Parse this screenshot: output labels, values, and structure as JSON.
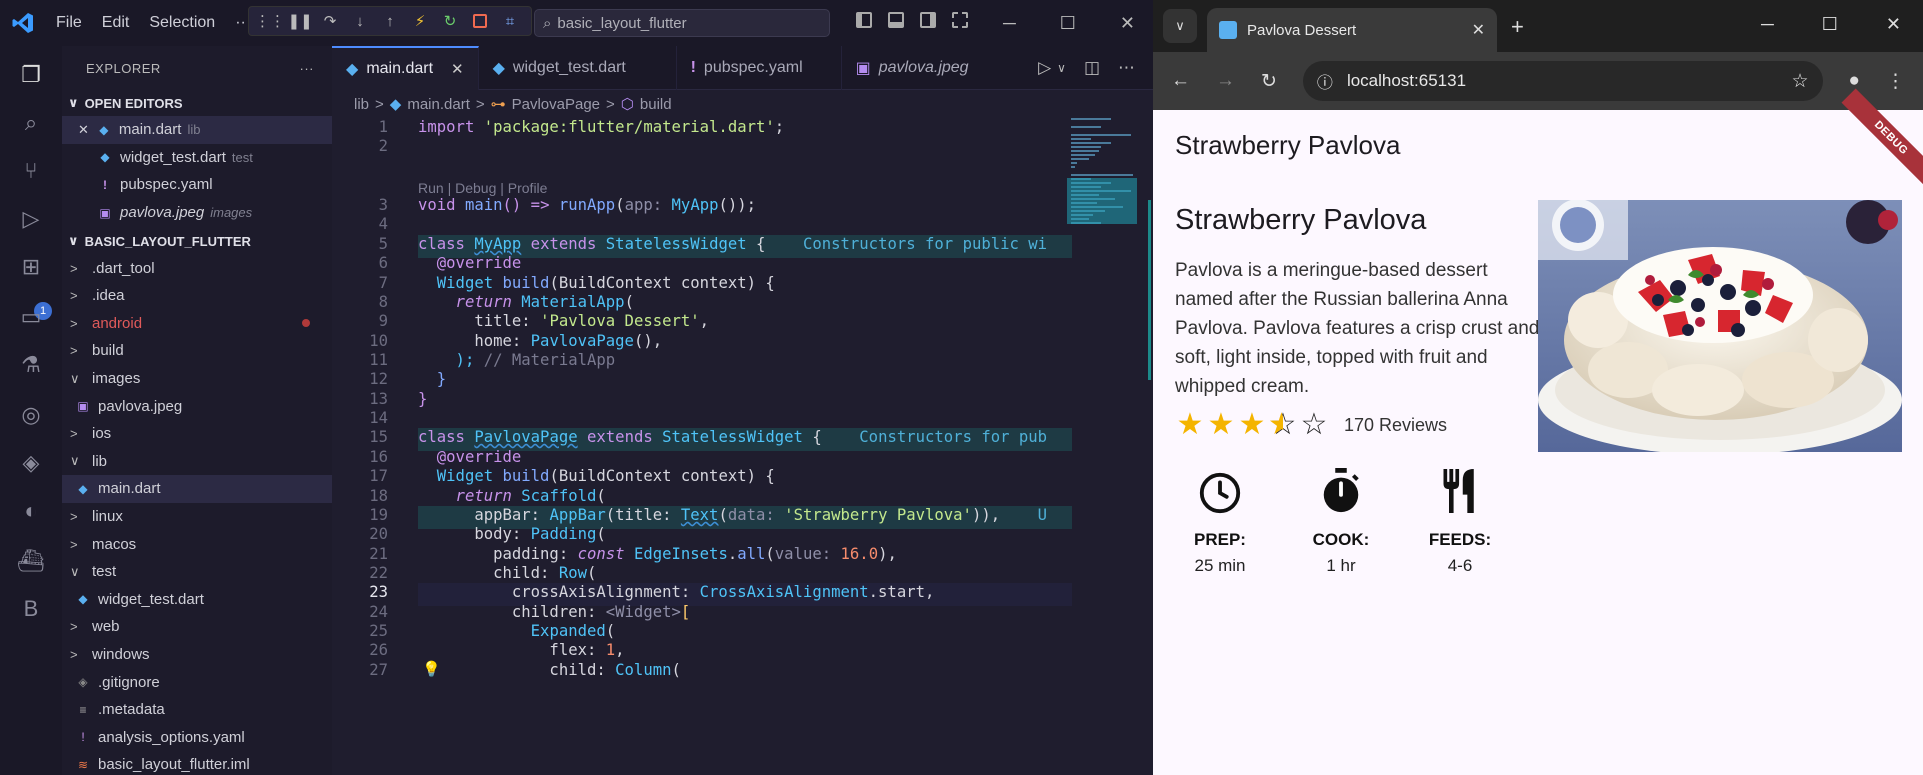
{
  "vscode": {
    "menu": [
      "File",
      "Edit",
      "Selection",
      "··"
    ],
    "search_text": "basic_layout_flutter",
    "activity_badge": "1",
    "explorer_title": "EXPLORER",
    "explorer_more": "···",
    "open_editors_title": "OPEN EDITORS",
    "open_editors": [
      {
        "close": "✕",
        "name": "main.dart",
        "desc": "lib"
      },
      {
        "name": "widget_test.dart",
        "desc": "test"
      },
      {
        "name": "pubspec.yaml",
        "desc": ""
      },
      {
        "name": "pavlova.jpeg",
        "desc": "images"
      }
    ],
    "project_title": "BASIC_LAYOUT_FLUTTER",
    "tree": [
      {
        "name": ".dart_tool",
        "chev": ">"
      },
      {
        "name": ".idea",
        "chev": ">"
      },
      {
        "name": "android",
        "chev": ">"
      },
      {
        "name": "build",
        "chev": ">"
      },
      {
        "name": "images",
        "chev": "∨"
      },
      {
        "name": "pavlova.jpeg",
        "chev": ""
      },
      {
        "name": "ios",
        "chev": ">"
      },
      {
        "name": "lib",
        "chev": "∨"
      },
      {
        "name": "main.dart",
        "chev": ""
      },
      {
        "name": "linux",
        "chev": ">"
      },
      {
        "name": "macos",
        "chev": ">"
      },
      {
        "name": "test",
        "chev": "∨"
      },
      {
        "name": "widget_test.dart",
        "chev": ""
      },
      {
        "name": "web",
        "chev": ">"
      },
      {
        "name": "windows",
        "chev": ">"
      },
      {
        "name": ".gitignore",
        "chev": ""
      },
      {
        "name": ".metadata",
        "chev": ""
      },
      {
        "name": "analysis_options.yaml",
        "chev": ""
      },
      {
        "name": "basic_layout_flutter.iml",
        "chev": ""
      }
    ],
    "tabs": [
      {
        "name": "main.dart",
        "close": "✕"
      },
      {
        "name": "widget_test.dart"
      },
      {
        "name": "pubspec.yaml"
      },
      {
        "name": "pavlova.jpeg"
      }
    ],
    "breadcrumb": [
      "lib",
      ">",
      "main.dart",
      ">",
      "PavlovaPage",
      ">",
      "build"
    ],
    "codelens": "Run | Debug | Profile",
    "line_numbers": [
      "1",
      "2",
      "3",
      "4",
      "5",
      "6",
      "7",
      "8",
      "9",
      "10",
      "11",
      "12",
      "13",
      "14",
      "15",
      "16",
      "17",
      "18",
      "19",
      "20",
      "21",
      "22",
      "23",
      "24",
      "25",
      "26",
      "27"
    ],
    "code": {
      "l1a": "import ",
      "l1b": "'package:flutter/material.dart'",
      "l1c": ";",
      "l3a": "void ",
      "l3b": "main",
      "l3c": "() => ",
      "l3d": "runApp",
      "l3e": "(",
      "l3f": "app:",
      "l3g": " MyApp",
      "l3h": "());",
      "l5a": "class ",
      "l5b": "MyApp",
      "l5c": " extends ",
      "l5d": "StatelessWidget",
      "l5e": " {    ",
      "l5f": "Constructors for public wi",
      "l6": "  @override",
      "l7a": "  Widget ",
      "l7b": "build",
      "l7c": "(BuildContext context) {",
      "l8a": "    return ",
      "l8b": "MaterialApp",
      "l8c": "(",
      "l9a": "      title: ",
      "l9b": "'Pavlova Dessert'",
      "l9c": ",",
      "l10a": "      home: ",
      "l10b": "PavlovaPage",
      "l10c": "(),",
      "l11a": "    ); ",
      "l11b": "// MaterialApp",
      "l12": "  }",
      "l13": "}",
      "l15a": "class ",
      "l15b": "PavlovaPage",
      "l15c": " extends ",
      "l15d": "StatelessWidget",
      "l15e": " {    ",
      "l15f": "Constructors for pub",
      "l16": "  @override",
      "l17a": "  Widget ",
      "l17b": "build",
      "l17c": "(BuildContext context) {",
      "l18a": "    return ",
      "l18b": "Scaffold",
      "l18c": "(",
      "l19a": "      appBar: ",
      "l19b": "AppBar",
      "l19c": "(title: ",
      "l19d": "Text",
      "l19e": "(",
      "l19f": "data:",
      "l19g": " 'Strawberry Pavlova'",
      "l19h": ")),    ",
      "l19i": "U",
      "l20a": "      body: ",
      "l20b": "Padding",
      "l20c": "(",
      "l21a": "        padding: ",
      "l21b": "const ",
      "l21c": "EdgeInsets",
      "l21d": ".",
      "l21e": "all",
      "l21f": "(",
      "l21g": "value:",
      "l21h": " 16.0",
      "l21i": "),",
      "l22a": "        child: ",
      "l22b": "Row",
      "l22c": "(",
      "l23a": "          crossAxisAlignment: ",
      "l23b": "CrossAxisAlignment",
      "l23c": ".start,",
      "l24a": "          children: ",
      "l24b": "<Widget>",
      "l24c": "[",
      "l25a": "            ",
      "l25b": "Expanded",
      "l25c": "(",
      "l26a": "              flex: ",
      "l26b": "1",
      "l26c": ",",
      "l27a": "              child: ",
      "l27b": "Column",
      "l27c": "("
    }
  },
  "browser": {
    "tab_title": "Pavlova Dessert",
    "tab_close": "✕",
    "new_tab": "+",
    "url": "localhost:65131",
    "app": {
      "appbar_title": "Strawberry Pavlova",
      "debug_banner": "DEBUG",
      "title": "Strawberry Pavlova",
      "description": "Pavlova is a meringue-based dessert named after the Russian ballerina Anna Pavlova. Pavlova features a crisp crust and soft, light inside, topped with fruit and whipped cream.",
      "rating": 3.5,
      "rating_max": 5,
      "reviews": "170 Reviews",
      "info": [
        {
          "icon": "clock-icon",
          "label": "PREP:",
          "value": "25 min"
        },
        {
          "icon": "timer-icon",
          "label": "COOK:",
          "value": "1 hr"
        },
        {
          "icon": "restaurant-icon",
          "label": "FEEDS:",
          "value": "4-6"
        }
      ]
    }
  },
  "colors": {
    "vscode_bg": "#1f1d2e",
    "accent": "#4e8cff",
    "star": "#f4b400",
    "debug_banner": "#a8323a",
    "page_bg": "#fdf8ff"
  }
}
